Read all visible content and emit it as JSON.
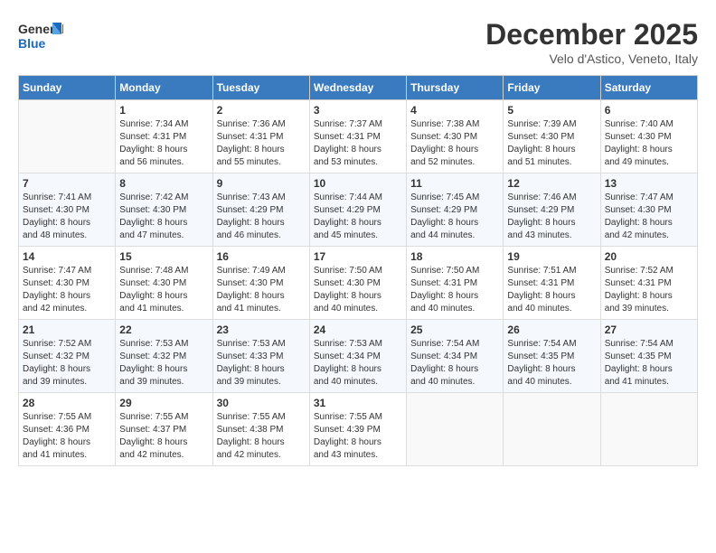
{
  "logo": {
    "line1": "General",
    "line2": "Blue"
  },
  "title": "December 2025",
  "subtitle": "Velo d'Astico, Veneto, Italy",
  "days_header": [
    "Sunday",
    "Monday",
    "Tuesday",
    "Wednesday",
    "Thursday",
    "Friday",
    "Saturday"
  ],
  "weeks": [
    [
      {
        "day": "",
        "content": ""
      },
      {
        "day": "1",
        "content": "Sunrise: 7:34 AM\nSunset: 4:31 PM\nDaylight: 8 hours\nand 56 minutes."
      },
      {
        "day": "2",
        "content": "Sunrise: 7:36 AM\nSunset: 4:31 PM\nDaylight: 8 hours\nand 55 minutes."
      },
      {
        "day": "3",
        "content": "Sunrise: 7:37 AM\nSunset: 4:31 PM\nDaylight: 8 hours\nand 53 minutes."
      },
      {
        "day": "4",
        "content": "Sunrise: 7:38 AM\nSunset: 4:30 PM\nDaylight: 8 hours\nand 52 minutes."
      },
      {
        "day": "5",
        "content": "Sunrise: 7:39 AM\nSunset: 4:30 PM\nDaylight: 8 hours\nand 51 minutes."
      },
      {
        "day": "6",
        "content": "Sunrise: 7:40 AM\nSunset: 4:30 PM\nDaylight: 8 hours\nand 49 minutes."
      }
    ],
    [
      {
        "day": "7",
        "content": "Sunrise: 7:41 AM\nSunset: 4:30 PM\nDaylight: 8 hours\nand 48 minutes."
      },
      {
        "day": "8",
        "content": "Sunrise: 7:42 AM\nSunset: 4:30 PM\nDaylight: 8 hours\nand 47 minutes."
      },
      {
        "day": "9",
        "content": "Sunrise: 7:43 AM\nSunset: 4:29 PM\nDaylight: 8 hours\nand 46 minutes."
      },
      {
        "day": "10",
        "content": "Sunrise: 7:44 AM\nSunset: 4:29 PM\nDaylight: 8 hours\nand 45 minutes."
      },
      {
        "day": "11",
        "content": "Sunrise: 7:45 AM\nSunset: 4:29 PM\nDaylight: 8 hours\nand 44 minutes."
      },
      {
        "day": "12",
        "content": "Sunrise: 7:46 AM\nSunset: 4:29 PM\nDaylight: 8 hours\nand 43 minutes."
      },
      {
        "day": "13",
        "content": "Sunrise: 7:47 AM\nSunset: 4:30 PM\nDaylight: 8 hours\nand 42 minutes."
      }
    ],
    [
      {
        "day": "14",
        "content": "Sunrise: 7:47 AM\nSunset: 4:30 PM\nDaylight: 8 hours\nand 42 minutes."
      },
      {
        "day": "15",
        "content": "Sunrise: 7:48 AM\nSunset: 4:30 PM\nDaylight: 8 hours\nand 41 minutes."
      },
      {
        "day": "16",
        "content": "Sunrise: 7:49 AM\nSunset: 4:30 PM\nDaylight: 8 hours\nand 41 minutes."
      },
      {
        "day": "17",
        "content": "Sunrise: 7:50 AM\nSunset: 4:30 PM\nDaylight: 8 hours\nand 40 minutes."
      },
      {
        "day": "18",
        "content": "Sunrise: 7:50 AM\nSunset: 4:31 PM\nDaylight: 8 hours\nand 40 minutes."
      },
      {
        "day": "19",
        "content": "Sunrise: 7:51 AM\nSunset: 4:31 PM\nDaylight: 8 hours\nand 40 minutes."
      },
      {
        "day": "20",
        "content": "Sunrise: 7:52 AM\nSunset: 4:31 PM\nDaylight: 8 hours\nand 39 minutes."
      }
    ],
    [
      {
        "day": "21",
        "content": "Sunrise: 7:52 AM\nSunset: 4:32 PM\nDaylight: 8 hours\nand 39 minutes."
      },
      {
        "day": "22",
        "content": "Sunrise: 7:53 AM\nSunset: 4:32 PM\nDaylight: 8 hours\nand 39 minutes."
      },
      {
        "day": "23",
        "content": "Sunrise: 7:53 AM\nSunset: 4:33 PM\nDaylight: 8 hours\nand 39 minutes."
      },
      {
        "day": "24",
        "content": "Sunrise: 7:53 AM\nSunset: 4:34 PM\nDaylight: 8 hours\nand 40 minutes."
      },
      {
        "day": "25",
        "content": "Sunrise: 7:54 AM\nSunset: 4:34 PM\nDaylight: 8 hours\nand 40 minutes."
      },
      {
        "day": "26",
        "content": "Sunrise: 7:54 AM\nSunset: 4:35 PM\nDaylight: 8 hours\nand 40 minutes."
      },
      {
        "day": "27",
        "content": "Sunrise: 7:54 AM\nSunset: 4:35 PM\nDaylight: 8 hours\nand 41 minutes."
      }
    ],
    [
      {
        "day": "28",
        "content": "Sunrise: 7:55 AM\nSunset: 4:36 PM\nDaylight: 8 hours\nand 41 minutes."
      },
      {
        "day": "29",
        "content": "Sunrise: 7:55 AM\nSunset: 4:37 PM\nDaylight: 8 hours\nand 42 minutes."
      },
      {
        "day": "30",
        "content": "Sunrise: 7:55 AM\nSunset: 4:38 PM\nDaylight: 8 hours\nand 42 minutes."
      },
      {
        "day": "31",
        "content": "Sunrise: 7:55 AM\nSunset: 4:39 PM\nDaylight: 8 hours\nand 43 minutes."
      },
      {
        "day": "",
        "content": ""
      },
      {
        "day": "",
        "content": ""
      },
      {
        "day": "",
        "content": ""
      }
    ]
  ]
}
